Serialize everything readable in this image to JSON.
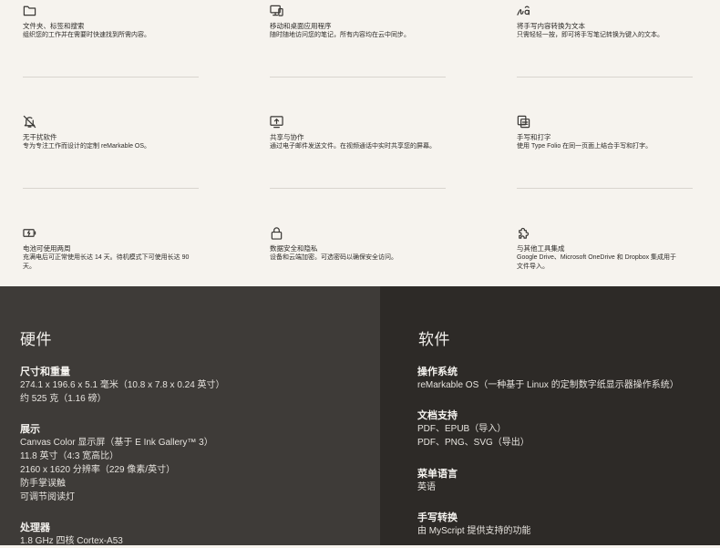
{
  "features": [
    {
      "icon": "folder-icon",
      "title": "文件夹、标签和搜索",
      "desc": [
        "组织您的工作并在需要时快速找到所需内容。"
      ]
    },
    {
      "icon": "monitor-phone-icon",
      "title": "移动和桌面应用程序",
      "desc": [
        "随时随地访问您的笔记，所有内容均在云中同步。"
      ]
    },
    {
      "icon": "handwriting-convert-icon",
      "title": "将手写内容转换为文本",
      "desc": [
        "只需轻轻一按，即可将手写笔记转换为键入的文本。"
      ]
    },
    {
      "icon": "bell-off-icon",
      "title": "无干扰软件",
      "desc": [
        "专为专注工作而设计的定制 reMarkable OS。"
      ]
    },
    {
      "icon": "share-screen-icon",
      "title": "共享与协作",
      "desc": [
        "通过电子邮件发送文件。在视频通话中实时共享您的屏幕。"
      ]
    },
    {
      "icon": "type-folio-icon",
      "title": "手写和打字",
      "desc": [
        "使用 Type Folio 在同一页面上结合手写和打字。"
      ]
    },
    {
      "icon": "battery-charging-icon",
      "title": "电池可使用两周",
      "desc": [
        "充满电后可正常使用长达 14 天。待机模式下可使用长达 90",
        "天。"
      ]
    },
    {
      "icon": "lock-icon",
      "title": "数据安全和隐私",
      "desc": [
        "设备和云端加密。可选密码以确保安全访问。"
      ]
    },
    {
      "icon": "puzzle-icon",
      "title": "与其他工具集成",
      "desc": [
        "Google Drive、Microsoft OneDrive 和 Dropbox 集成用于",
        "文件导入。"
      ]
    }
  ],
  "hardware": {
    "heading": "硬件",
    "groups": [
      {
        "title": "尺寸和重量",
        "lines": [
          "274.1 x 196.6 x 5.1 毫米（10.8 x 7.8 x 0.24 英寸）",
          "约 525 克（1.16 磅）"
        ]
      },
      {
        "title": "展示",
        "lines": [
          "Canvas Color 显示屏（基于 E Ink Gallery™ 3）",
          "11.8 英寸（4:3 宽高比）",
          "2160 x 1620 分辨率（229 像素/英寸）",
          "防手掌误触",
          "可调节阅读灯"
        ]
      },
      {
        "title": "处理器",
        "lines": [
          "1.8 GHz 四核 Cortex-A53"
        ]
      }
    ]
  },
  "software": {
    "heading": "软件",
    "groups": [
      {
        "title": "操作系统",
        "lines": [
          "reMarkable OS（一种基于 Linux 的定制数字纸显示器操作系统）"
        ]
      },
      {
        "title": "文档支持",
        "lines": [
          "PDF、EPUB（导入）",
          "PDF、PNG、SVG（导出）"
        ]
      },
      {
        "title": "菜单语言",
        "lines": [
          "英语"
        ]
      },
      {
        "title": "手写转换",
        "lines": [
          "由 MyScript 提供支持的功能"
        ]
      }
    ]
  }
}
